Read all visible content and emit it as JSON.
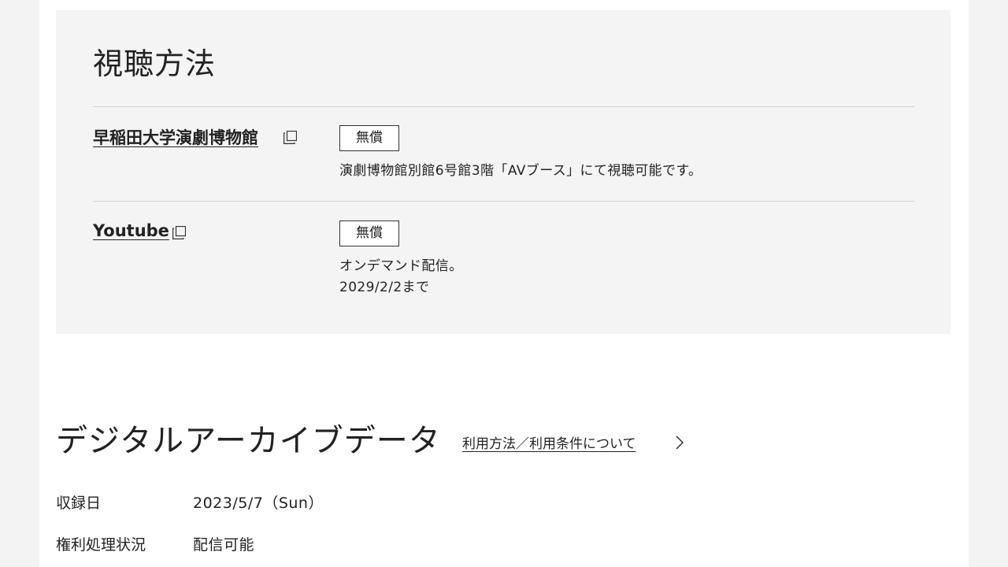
{
  "viewing": {
    "title": "視聴方法",
    "methods": [
      {
        "name": "早稲田大学演劇博物館",
        "price": "無償",
        "description_lines": [
          "演劇博物館別館6号館3階「AVブース」にて視聴可能です。"
        ]
      },
      {
        "name": "Youtube",
        "price": "無償",
        "description_lines": [
          "オンデマンド配信。",
          "2029/2/2まで"
        ]
      }
    ]
  },
  "archive": {
    "title": "デジタルアーカイブデータ",
    "usage_link": "利用方法／利用条件について",
    "info": [
      {
        "label": "収録日",
        "value": "2023/5/7（Sun）"
      },
      {
        "label": "権利処理状況",
        "value": "配信可能"
      }
    ]
  },
  "icons": {
    "external_link": "external-window-icon",
    "chevron": "chevron-right-icon"
  }
}
